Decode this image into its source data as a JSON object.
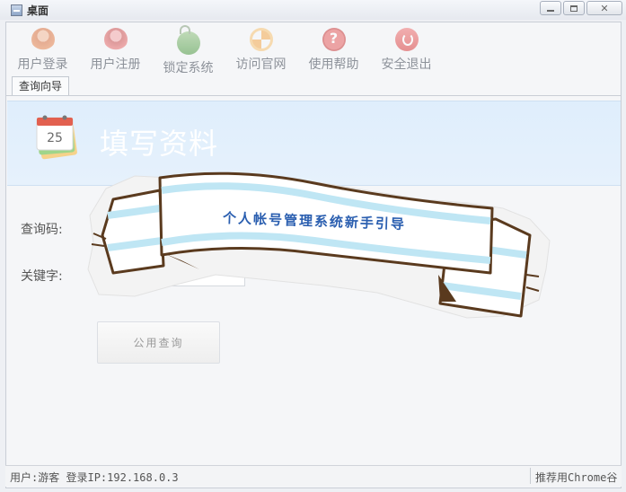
{
  "window": {
    "title": "桌面"
  },
  "toolbar": {
    "items": [
      {
        "label": "用户登录",
        "icon": "user-login-icon"
      },
      {
        "label": "用户注册",
        "icon": "user-register-icon"
      },
      {
        "label": "锁定系统",
        "icon": "lock-icon"
      },
      {
        "label": "访问官网",
        "icon": "refresh-web-icon"
      },
      {
        "label": "使用帮助",
        "icon": "help-icon"
      },
      {
        "label": "安全退出",
        "icon": "power-icon"
      }
    ]
  },
  "tabs": [
    {
      "label": "查询向导"
    }
  ],
  "banner": {
    "title": "填写资料",
    "icon": "calendar-icon"
  },
  "form": {
    "code_label": "查询码:",
    "code_value": "",
    "keyword_label": "关键字:",
    "keyword_value": "",
    "submit_label": "公用查询"
  },
  "overlay": {
    "ribbon_text": "个人帐号管理系统新手引导"
  },
  "status": {
    "user": "用户:游客",
    "login_ip": "登录IP:192.168.0.3",
    "recommend": "推荐用Chrome谷"
  },
  "colors": {
    "banner_bg": "#dfeefc",
    "ribbon_stripe": "#bfe6f4",
    "ribbon_outline": "#5a3a1e",
    "ribbon_text": "#2b5fb0"
  }
}
